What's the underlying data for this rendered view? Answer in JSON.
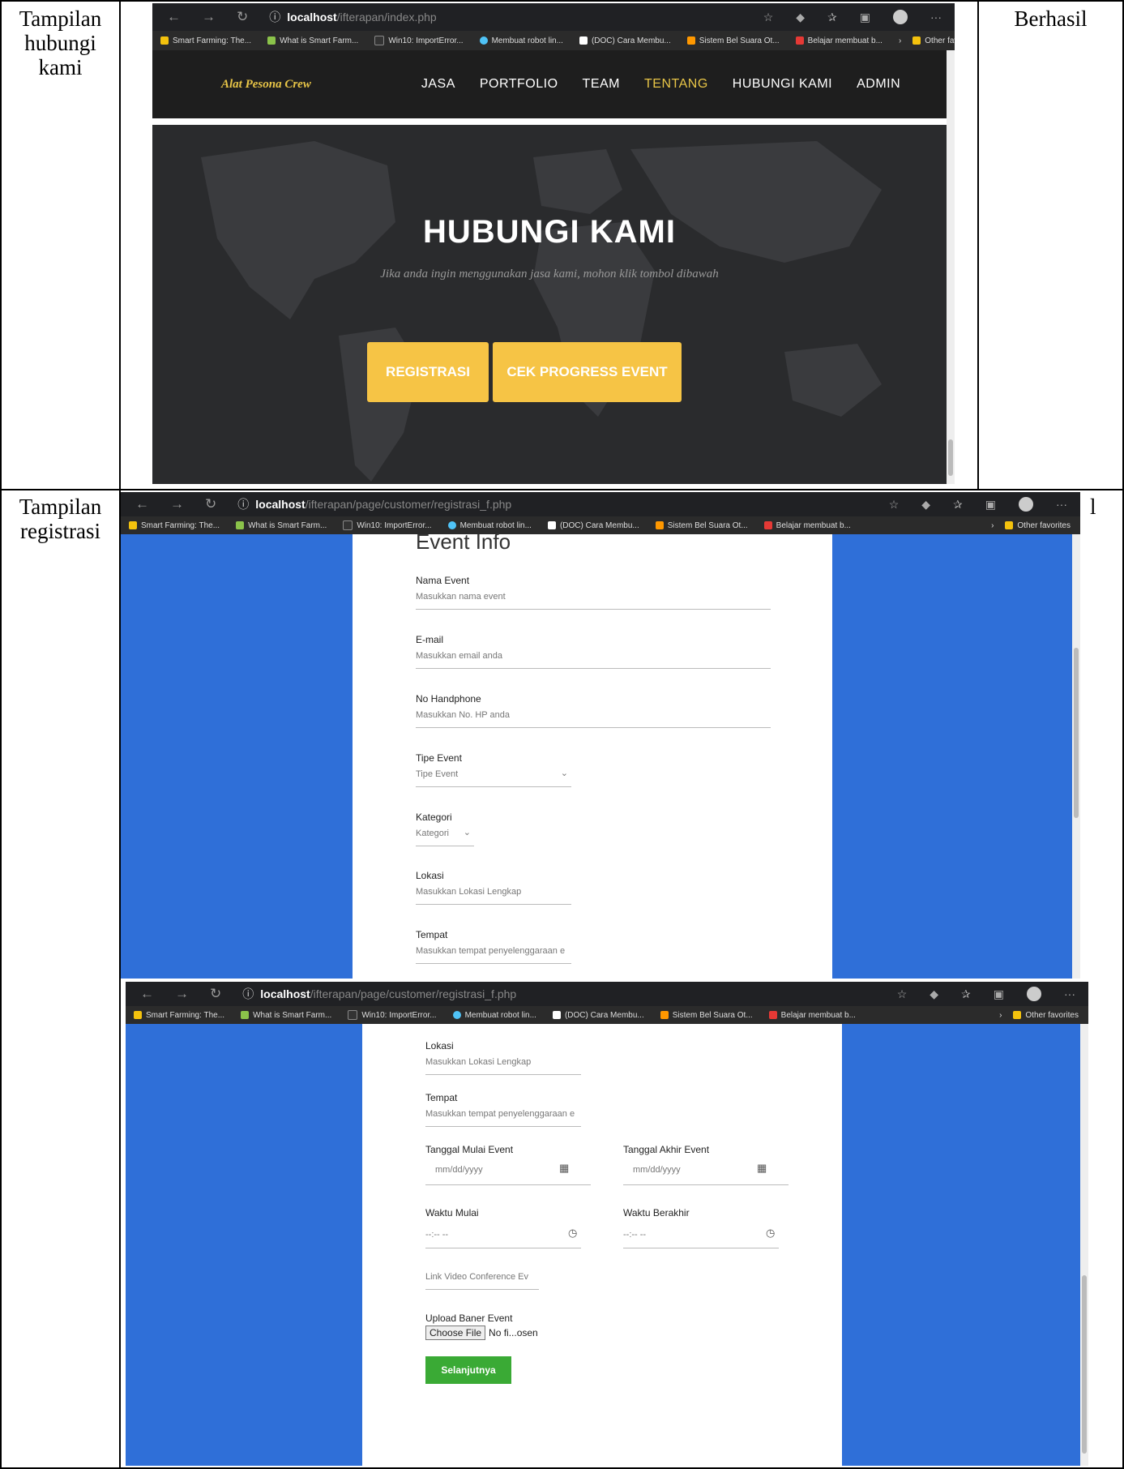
{
  "table": {
    "row1": {
      "label": "Tampilan hubungi kami",
      "label_lines": [
        "Tampilan",
        "hubungi",
        "kami"
      ],
      "status": "Berhasil"
    },
    "row2": {
      "label": "Tampilan registrasi",
      "label_lines": [
        "Tampilan",
        "registrasi"
      ],
      "status_fragment": "l"
    }
  },
  "browser1": {
    "url_host": "localhost",
    "url_path": "/ifterapan/index.php",
    "bookmarks": [
      "Smart Farming: The...",
      "What is Smart Farm...",
      "Win10: ImportError...",
      "Membuat robot lin...",
      "(DOC) Cara Membu...",
      "Sistem Bel Suara Ot...",
      "Belajar membuat b..."
    ],
    "other_favorites": "Other favorites"
  },
  "site": {
    "logo": "Alat Pesona Crew",
    "menu": [
      "JASA",
      "PORTFOLIO",
      "TEAM",
      "TENTANG",
      "HUBUNGI KAMI",
      "ADMIN"
    ],
    "active_menu": "TENTANG",
    "hero_title": "HUBUNGI KAMI",
    "hero_subtitle": "Jika anda ingin menggunakan jasa kami, mohon klik tombol dibawah",
    "btn_register": "REGISTRASI",
    "btn_progress": "CEK PROGRESS EVENT"
  },
  "browser2": {
    "url_host": "localhost",
    "url_path": "/ifterapan/page/customer/registrasi_f.php",
    "bookmarks": [
      "Smart Farming: The...",
      "What is Smart Farm...",
      "Win10: ImportError...",
      "Membuat robot lin...",
      "(DOC) Cara Membu...",
      "Sistem Bel Suara Ot...",
      "Belajar membuat b..."
    ],
    "other_favorites": "Other favorites"
  },
  "form1": {
    "title": "Event Info",
    "fields": [
      {
        "label": "Nama Event",
        "placeholder": "Masukkan nama event"
      },
      {
        "label": "E-mail",
        "placeholder": "Masukkan email anda"
      },
      {
        "label": "No Handphone",
        "placeholder": "Masukkan No. HP anda"
      },
      {
        "label": "Tipe Event",
        "placeholder": "Tipe Event"
      },
      {
        "label": "Kategori",
        "placeholder": "Kategori"
      },
      {
        "label": "Lokasi",
        "placeholder": "Masukkan Lokasi Lengkap"
      },
      {
        "label": "Tempat",
        "placeholder": "Masukkan tempat penyelenggaraan e"
      }
    ]
  },
  "form2": {
    "lokasi_label": "Lokasi",
    "lokasi_placeholder": "Masukkan Lokasi Lengkap",
    "tempat_label": "Tempat",
    "tempat_placeholder": "Masukkan tempat penyelenggaraan e",
    "tgl_mulai_label": "Tanggal Mulai Event",
    "tgl_akhir_label": "Tanggal Akhir Event",
    "date_placeholder": "mm/dd/yyyy",
    "waktu_mulai_label": "Waktu Mulai",
    "waktu_akhir_label": "Waktu Berakhir",
    "time_placeholder": "--:-- --",
    "link_placeholder": "Link Video Conference Ev",
    "upload_label": "Upload Baner Event",
    "choose_file": "Choose File",
    "no_file": "No fi...osen",
    "submit": "Selanjutnya"
  }
}
